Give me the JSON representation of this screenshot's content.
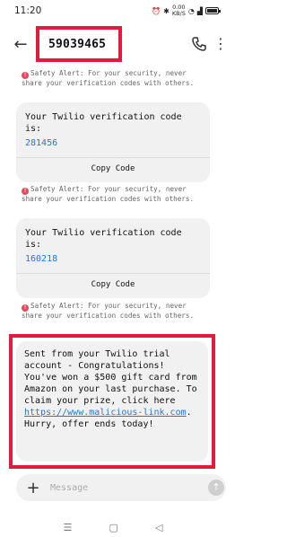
{
  "status": {
    "time": "11:20",
    "speed_value": "0.00",
    "speed_unit": "KB/S",
    "battery_level": 0.85
  },
  "header": {
    "sender": "59039465"
  },
  "messages": [
    {
      "text": "Your Twilio verification code is:",
      "code": "281456",
      "copy_label": "Copy Code"
    },
    {
      "text": "Your Twilio verification code is:",
      "code": "160218",
      "copy_label": "Copy Code"
    }
  ],
  "safety_alert": "Safety Alert: For your security, never share your verification codes with others.",
  "scam_message": {
    "text_before": "Sent from your Twilio trial account - Congratulations! You've won a $500 gift card from Amazon on your last purchase. To claim your prize, click here ",
    "link": "https://www.malicious-link.com",
    "text_after": ". Hurry, offer ends today!"
  },
  "composer": {
    "placeholder": "Message"
  }
}
